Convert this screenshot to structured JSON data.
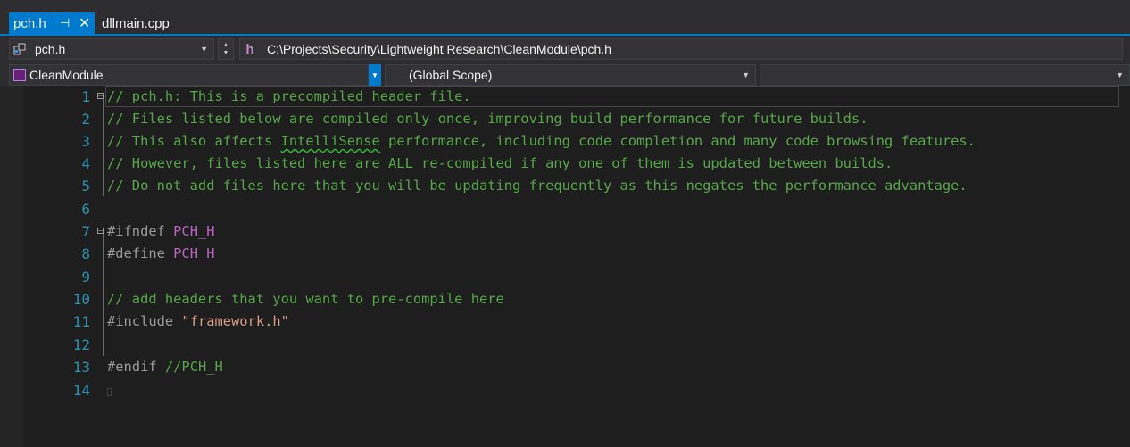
{
  "tabs": [
    {
      "label": "pch.h",
      "active": true,
      "pin_icon": "pin-icon",
      "close_icon": "close-icon"
    },
    {
      "label": "dllmain.cpp",
      "active": false
    }
  ],
  "filebar": {
    "file_combo": "pch.h",
    "path": "C:\\Projects\\Security\\Lightweight Research\\CleanModule\\pch.h"
  },
  "navbar": {
    "project": "CleanModule",
    "scope": "(Global Scope)",
    "member": ""
  },
  "editor": {
    "lines": [
      {
        "num": "1"
      },
      {
        "num": "2"
      },
      {
        "num": "3"
      },
      {
        "num": "4"
      },
      {
        "num": "5"
      },
      {
        "num": "6"
      },
      {
        "num": "7"
      },
      {
        "num": "8"
      },
      {
        "num": "9"
      },
      {
        "num": "10"
      },
      {
        "num": "11"
      },
      {
        "num": "12"
      },
      {
        "num": "13"
      },
      {
        "num": "14"
      }
    ],
    "code": {
      "l1": "// pch.h: This is a precompiled header file.",
      "l2": "// Files listed below are compiled only once, improving build performance for future builds.",
      "l3_a": "// This also affects ",
      "l3_b": "IntelliSense",
      "l3_c": " performance, including code completion and many code browsing features.",
      "l4": "// However, files listed here are ALL re-compiled if any one of them is updated between builds.",
      "l5": "// Do not add files here that you will be updating frequently as this negates the performance advantage.",
      "l7_kw": "#ifndef",
      "l7_macro": "PCH_H",
      "l8_kw": "#define",
      "l8_macro": "PCH_H",
      "l10": "// add headers that you want to pre-compile here",
      "l11_kw": "#include",
      "l11_str": "\"framework.h\"",
      "l13_kw": "#endif",
      "l13_comment": "//PCH_H"
    }
  },
  "colors": {
    "accent": "#007acc",
    "comment": "#57a64a",
    "macro": "#bd63c5",
    "string": "#d69d85",
    "line_number": "#2b91af"
  }
}
